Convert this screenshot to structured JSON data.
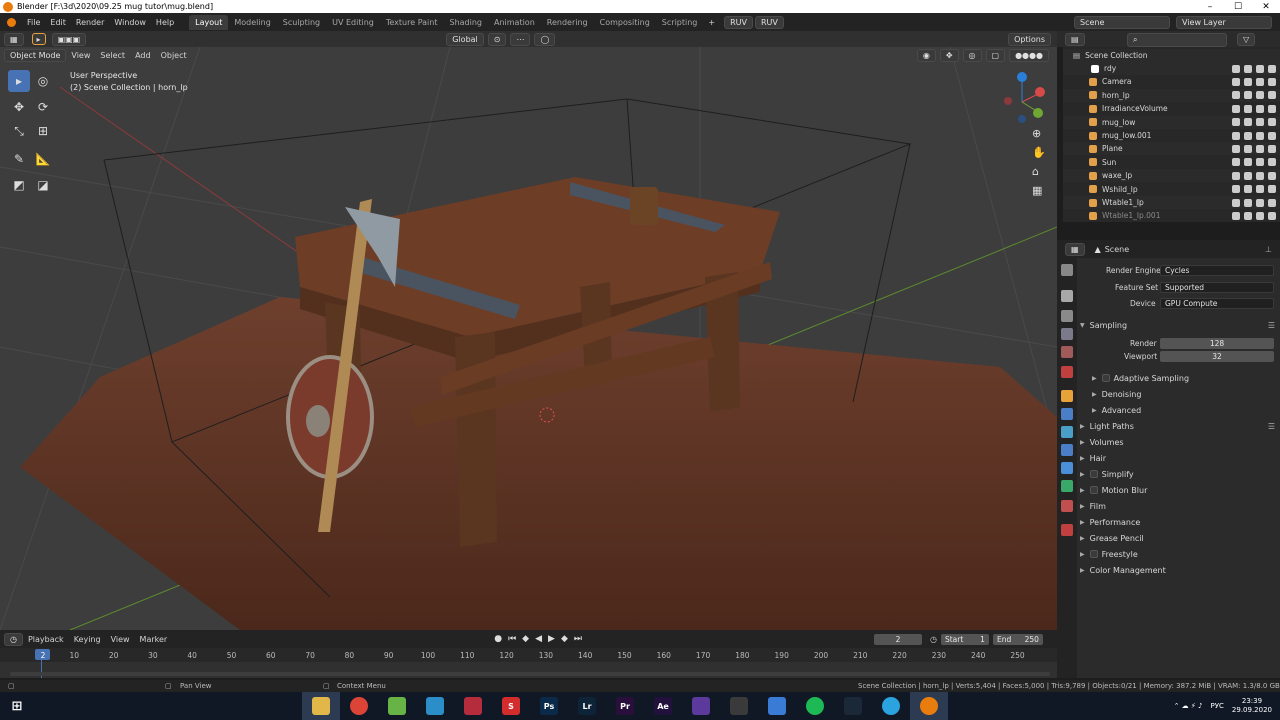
{
  "window": {
    "title": "Blender [F:\\3d\\2020\\09.25 mug tutor\\mug.blend]",
    "min": "–",
    "max": "☐",
    "close": "✕"
  },
  "menu": [
    "File",
    "Edit",
    "Render",
    "Window",
    "Help"
  ],
  "workspaces": [
    {
      "label": "Layout",
      "active": true
    },
    {
      "label": "Modeling"
    },
    {
      "label": "Sculpting"
    },
    {
      "label": "UV Editing"
    },
    {
      "label": "Texture Paint"
    },
    {
      "label": "Shading"
    },
    {
      "label": "Animation"
    },
    {
      "label": "Rendering"
    },
    {
      "label": "Compositing"
    },
    {
      "label": "Scripting"
    }
  ],
  "addons": {
    "plus": "+",
    "ruv1": "RUV",
    "ruv2": "RUV"
  },
  "scene_field": "Scene",
  "view_layer_field": "View Layer",
  "viewport_header": {
    "mode": "Object Mode",
    "view": "View",
    "select": "Select",
    "add": "Add",
    "object": "Object",
    "orientation": "Global",
    "options": "Options"
  },
  "viewport": {
    "line1": "User Perspective",
    "line2": "(2) Scene Collection | horn_lp"
  },
  "outliner": {
    "title": "Scene Collection",
    "items": [
      {
        "name": "rdy",
        "icon": "checkbox",
        "color": "#ffffff"
      },
      {
        "name": "Camera",
        "icon": "camera-icon",
        "color": "#e2a04a"
      },
      {
        "name": "horn_lp",
        "icon": "mesh-icon",
        "color": "#e2a04a"
      },
      {
        "name": "IrradianceVolume",
        "icon": "lightprobe-icon",
        "color": "#e2a04a"
      },
      {
        "name": "mug_low",
        "icon": "mesh-icon",
        "color": "#e2a04a"
      },
      {
        "name": "mug_low.001",
        "icon": "mesh-icon",
        "color": "#e2a04a"
      },
      {
        "name": "Plane",
        "icon": "mesh-icon",
        "color": "#e2a04a"
      },
      {
        "name": "Sun",
        "icon": "light-icon",
        "color": "#e2a04a"
      },
      {
        "name": "waxe_lp",
        "icon": "mesh-icon",
        "color": "#e2a04a"
      },
      {
        "name": "Wshild_lp",
        "icon": "mesh-icon",
        "color": "#e2a04a"
      },
      {
        "name": "Wtable1_lp",
        "icon": "mesh-icon",
        "color": "#e2a04a"
      },
      {
        "name": "Wtable1_lp.001",
        "icon": "mesh-icon",
        "color": "#e2a04a"
      }
    ]
  },
  "properties": {
    "scene_label": "Scene",
    "render_engine_label": "Render Engine",
    "render_engine": "Cycles",
    "feature_set_label": "Feature Set",
    "feature_set": "Supported",
    "device_label": "Device",
    "device": "GPU Compute",
    "sampling": "Sampling",
    "render_label": "Render",
    "render_value": "128",
    "viewport_label": "Viewport",
    "viewport_value": "32",
    "adaptive_sampling": "Adaptive Sampling",
    "denoising": "Denoising",
    "advanced": "Advanced",
    "panels": [
      "Light Paths",
      "Volumes",
      "Hair",
      "Simplify",
      "Motion Blur",
      "Film",
      "Performance",
      "Grease Pencil",
      "Freestyle",
      "Color Management"
    ]
  },
  "timeline": {
    "playback": "Playback",
    "keying": "Keying",
    "view": "View",
    "marker": "Marker",
    "current_frame": "2",
    "start_label": "Start",
    "start": "1",
    "end_label": "End",
    "end": "250",
    "ticks": [
      "2",
      "10",
      "20",
      "30",
      "40",
      "50",
      "60",
      "70",
      "80",
      "90",
      "100",
      "110",
      "120",
      "130",
      "140",
      "150",
      "160",
      "170",
      "180",
      "190",
      "200",
      "210",
      "220",
      "230",
      "240",
      "250"
    ]
  },
  "status": {
    "pan": "Pan View",
    "context": "Context Menu",
    "stats": "Scene Collection | horn_lp | Verts:5,404 | Faces:5,000 | Tris:9,789 | Objects:0/21 | Memory: 387.2 MiB | VRAM: 1.3/8.0 GB"
  },
  "taskbar": {
    "apps": [
      {
        "name": "file-explorer",
        "label": "",
        "color": "#e2b74a"
      },
      {
        "name": "chrome",
        "label": "",
        "color": "#db4437"
      },
      {
        "name": "utorrent",
        "label": "",
        "color": "#67b346"
      },
      {
        "name": "app-blue",
        "label": "",
        "color": "#2b8ec9"
      },
      {
        "name": "app-red",
        "label": "",
        "color": "#b52d3d"
      },
      {
        "name": "app-s",
        "label": "S",
        "color": "#d32c2c"
      },
      {
        "name": "photoshop",
        "label": "Ps",
        "color": "#0b2a4a"
      },
      {
        "name": "lightroom",
        "label": "Lr",
        "color": "#0d2338"
      },
      {
        "name": "premiere",
        "label": "Pr",
        "color": "#2a0f3d"
      },
      {
        "name": "after-effects",
        "label": "Ae",
        "color": "#22103d"
      },
      {
        "name": "app-purple",
        "label": "",
        "color": "#5b3a9c"
      },
      {
        "name": "app-fox",
        "label": "",
        "color": "#3a3a3a"
      },
      {
        "name": "app-bolt",
        "label": "",
        "color": "#3a7bd5"
      },
      {
        "name": "spotify",
        "label": "",
        "color": "#1db954"
      },
      {
        "name": "steam",
        "label": "",
        "color": "#1b2838"
      },
      {
        "name": "telegram",
        "label": "",
        "color": "#2aa3de"
      },
      {
        "name": "blender",
        "label": "",
        "color": "#e87d0d"
      }
    ],
    "lang": "РУС",
    "time": "23:39",
    "date": "29.09.2020"
  }
}
